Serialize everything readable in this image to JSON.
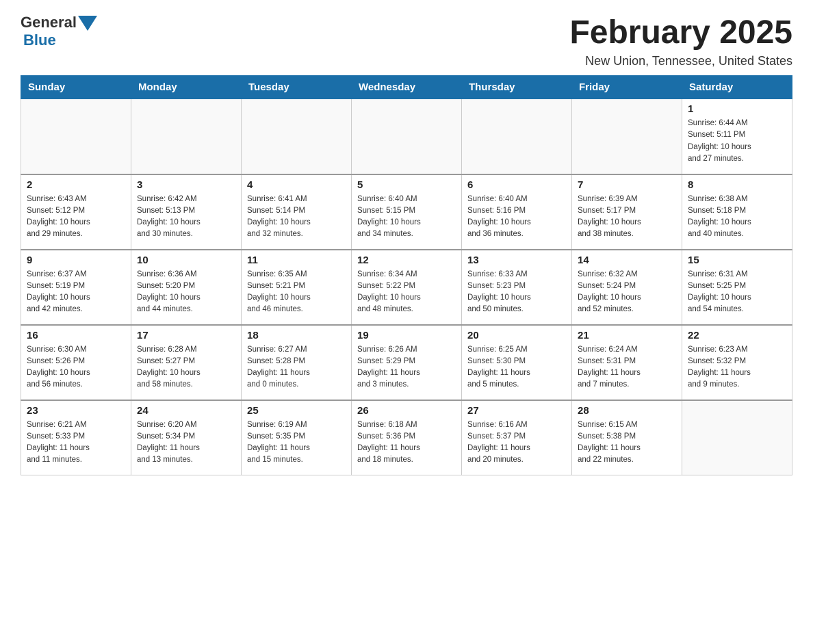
{
  "header": {
    "logo_general": "General",
    "logo_blue": "Blue",
    "title": "February 2025",
    "subtitle": "New Union, Tennessee, United States"
  },
  "calendar": {
    "days_of_week": [
      "Sunday",
      "Monday",
      "Tuesday",
      "Wednesday",
      "Thursday",
      "Friday",
      "Saturday"
    ],
    "weeks": [
      [
        {
          "day": "",
          "info": ""
        },
        {
          "day": "",
          "info": ""
        },
        {
          "day": "",
          "info": ""
        },
        {
          "day": "",
          "info": ""
        },
        {
          "day": "",
          "info": ""
        },
        {
          "day": "",
          "info": ""
        },
        {
          "day": "1",
          "info": "Sunrise: 6:44 AM\nSunset: 5:11 PM\nDaylight: 10 hours\nand 27 minutes."
        }
      ],
      [
        {
          "day": "2",
          "info": "Sunrise: 6:43 AM\nSunset: 5:12 PM\nDaylight: 10 hours\nand 29 minutes."
        },
        {
          "day": "3",
          "info": "Sunrise: 6:42 AM\nSunset: 5:13 PM\nDaylight: 10 hours\nand 30 minutes."
        },
        {
          "day": "4",
          "info": "Sunrise: 6:41 AM\nSunset: 5:14 PM\nDaylight: 10 hours\nand 32 minutes."
        },
        {
          "day": "5",
          "info": "Sunrise: 6:40 AM\nSunset: 5:15 PM\nDaylight: 10 hours\nand 34 minutes."
        },
        {
          "day": "6",
          "info": "Sunrise: 6:40 AM\nSunset: 5:16 PM\nDaylight: 10 hours\nand 36 minutes."
        },
        {
          "day": "7",
          "info": "Sunrise: 6:39 AM\nSunset: 5:17 PM\nDaylight: 10 hours\nand 38 minutes."
        },
        {
          "day": "8",
          "info": "Sunrise: 6:38 AM\nSunset: 5:18 PM\nDaylight: 10 hours\nand 40 minutes."
        }
      ],
      [
        {
          "day": "9",
          "info": "Sunrise: 6:37 AM\nSunset: 5:19 PM\nDaylight: 10 hours\nand 42 minutes."
        },
        {
          "day": "10",
          "info": "Sunrise: 6:36 AM\nSunset: 5:20 PM\nDaylight: 10 hours\nand 44 minutes."
        },
        {
          "day": "11",
          "info": "Sunrise: 6:35 AM\nSunset: 5:21 PM\nDaylight: 10 hours\nand 46 minutes."
        },
        {
          "day": "12",
          "info": "Sunrise: 6:34 AM\nSunset: 5:22 PM\nDaylight: 10 hours\nand 48 minutes."
        },
        {
          "day": "13",
          "info": "Sunrise: 6:33 AM\nSunset: 5:23 PM\nDaylight: 10 hours\nand 50 minutes."
        },
        {
          "day": "14",
          "info": "Sunrise: 6:32 AM\nSunset: 5:24 PM\nDaylight: 10 hours\nand 52 minutes."
        },
        {
          "day": "15",
          "info": "Sunrise: 6:31 AM\nSunset: 5:25 PM\nDaylight: 10 hours\nand 54 minutes."
        }
      ],
      [
        {
          "day": "16",
          "info": "Sunrise: 6:30 AM\nSunset: 5:26 PM\nDaylight: 10 hours\nand 56 minutes."
        },
        {
          "day": "17",
          "info": "Sunrise: 6:28 AM\nSunset: 5:27 PM\nDaylight: 10 hours\nand 58 minutes."
        },
        {
          "day": "18",
          "info": "Sunrise: 6:27 AM\nSunset: 5:28 PM\nDaylight: 11 hours\nand 0 minutes."
        },
        {
          "day": "19",
          "info": "Sunrise: 6:26 AM\nSunset: 5:29 PM\nDaylight: 11 hours\nand 3 minutes."
        },
        {
          "day": "20",
          "info": "Sunrise: 6:25 AM\nSunset: 5:30 PM\nDaylight: 11 hours\nand 5 minutes."
        },
        {
          "day": "21",
          "info": "Sunrise: 6:24 AM\nSunset: 5:31 PM\nDaylight: 11 hours\nand 7 minutes."
        },
        {
          "day": "22",
          "info": "Sunrise: 6:23 AM\nSunset: 5:32 PM\nDaylight: 11 hours\nand 9 minutes."
        }
      ],
      [
        {
          "day": "23",
          "info": "Sunrise: 6:21 AM\nSunset: 5:33 PM\nDaylight: 11 hours\nand 11 minutes."
        },
        {
          "day": "24",
          "info": "Sunrise: 6:20 AM\nSunset: 5:34 PM\nDaylight: 11 hours\nand 13 minutes."
        },
        {
          "day": "25",
          "info": "Sunrise: 6:19 AM\nSunset: 5:35 PM\nDaylight: 11 hours\nand 15 minutes."
        },
        {
          "day": "26",
          "info": "Sunrise: 6:18 AM\nSunset: 5:36 PM\nDaylight: 11 hours\nand 18 minutes."
        },
        {
          "day": "27",
          "info": "Sunrise: 6:16 AM\nSunset: 5:37 PM\nDaylight: 11 hours\nand 20 minutes."
        },
        {
          "day": "28",
          "info": "Sunrise: 6:15 AM\nSunset: 5:38 PM\nDaylight: 11 hours\nand 22 minutes."
        },
        {
          "day": "",
          "info": ""
        }
      ]
    ]
  }
}
